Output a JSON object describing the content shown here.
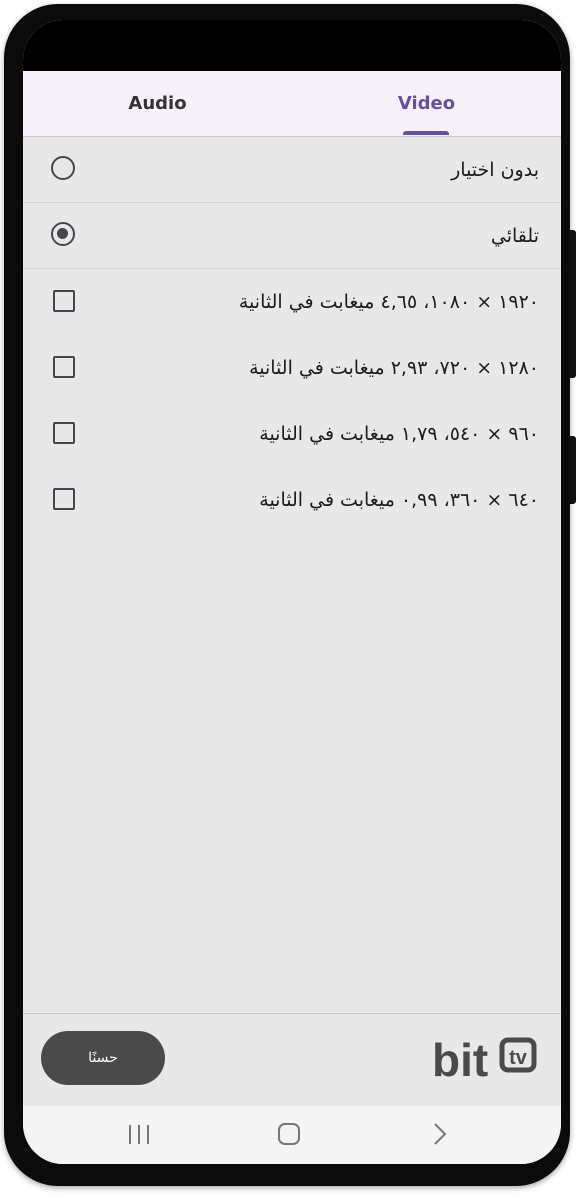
{
  "tabs": {
    "audio_label": "Audio",
    "video_label": "Video",
    "active": "Video"
  },
  "options": [
    {
      "label": "بدون اختيار",
      "control": "radio",
      "checked": false
    },
    {
      "label": "تلقائي",
      "control": "radio",
      "checked": true
    },
    {
      "label": "١٩٢٠ × ١٠٨٠، ٤,٦٥ ميغابت في الثانية",
      "control": "checkbox",
      "checked": false
    },
    {
      "label": "١٢٨٠ × ٧٢٠، ٢,٩٣ ميغابت في الثانية",
      "control": "checkbox",
      "checked": false
    },
    {
      "label": "٩٦٠ × ٥٤٠، ١,٧٩ ميغابت في الثانية",
      "control": "checkbox",
      "checked": false
    },
    {
      "label": "٦٤٠ × ٣٦٠، ٠,٩٩ ميغابت في الثانية",
      "control": "checkbox",
      "checked": false
    }
  ],
  "footer": {
    "ok_label": "حسنًا",
    "logo_text": "bit",
    "logo_accent_text": "tv"
  },
  "navbar": {
    "icons": [
      "recent-apps-icon",
      "home-icon",
      "back-icon"
    ]
  },
  "colors": {
    "accent": "#6750a4",
    "button_bg": "#4a4a4a",
    "logo": "#4a4a4a"
  }
}
